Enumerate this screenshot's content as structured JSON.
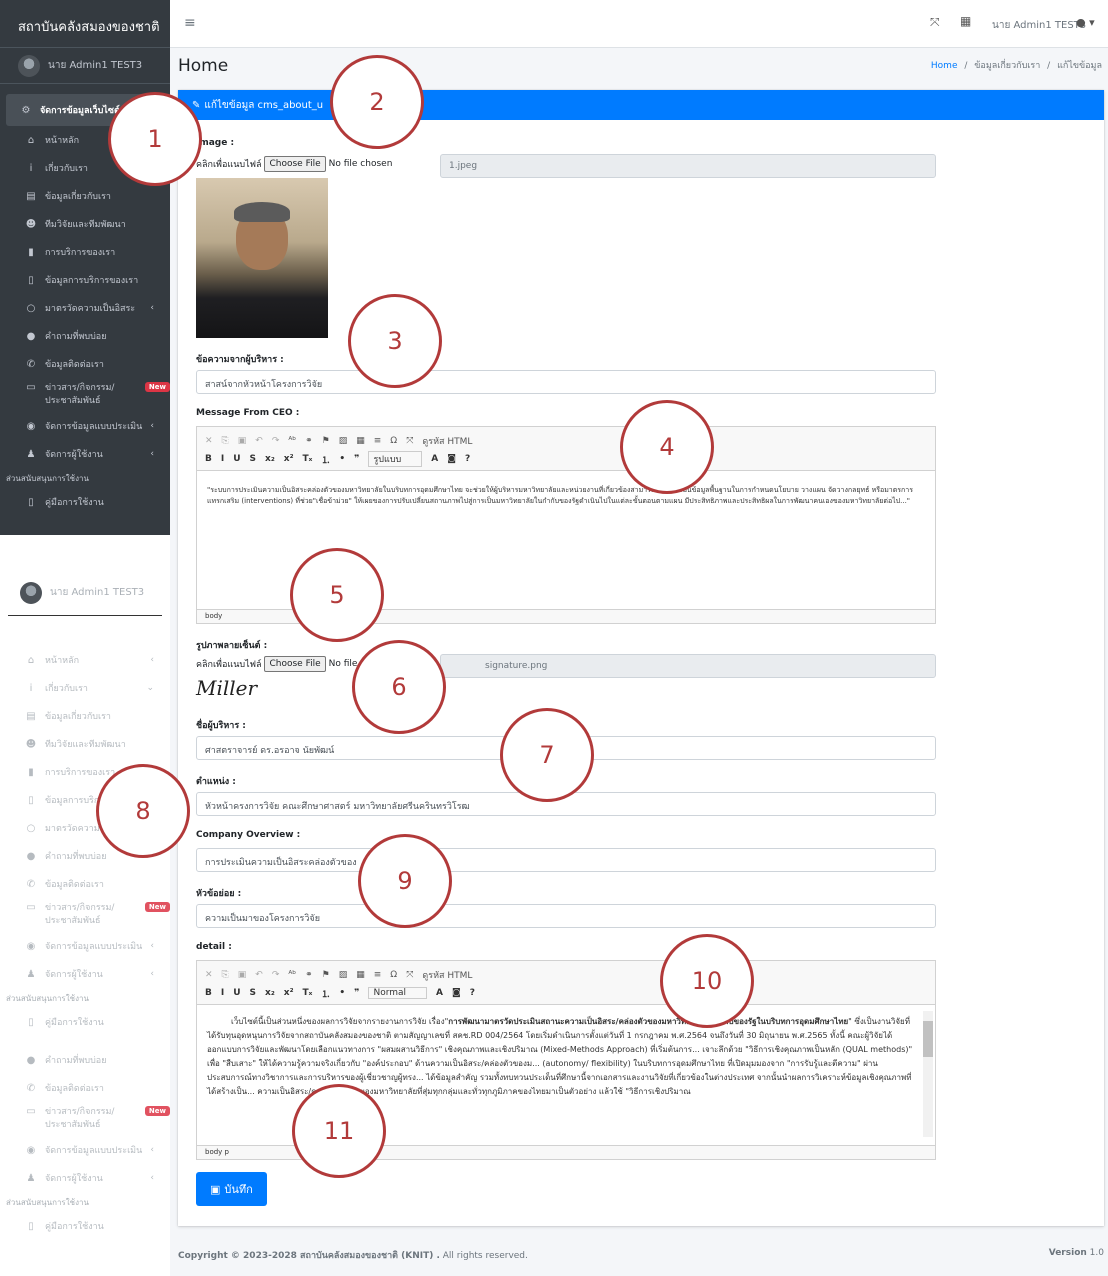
{
  "sidebar": {
    "brand": "สถาบันคลังสมองของชาติ",
    "user": "นาย Admin1 TEST3",
    "items": [
      {
        "label": "จัดการข้อมูลเว็บไซต์",
        "icon": "cogs-icon"
      },
      {
        "label": "หน้าหลัก",
        "icon": "home-icon"
      },
      {
        "label": "เกี่ยวกับเรา",
        "icon": "info-icon"
      },
      {
        "label": "ข้อมูลเกี่ยวกับเรา",
        "icon": "id-card-icon"
      },
      {
        "label": "ทีมวิจัยและทีมพัฒนา",
        "icon": "users-icon"
      },
      {
        "label": "การบริการของเรา",
        "icon": "clipboard-icon"
      },
      {
        "label": "ข้อมูลการบริการของเรา",
        "icon": "clipboard-list-icon"
      },
      {
        "label": "มาตรวัดความเป็นอิสระ",
        "icon": "circle-icon"
      },
      {
        "label": "คำถามที่พบบ่อย",
        "icon": "comments-icon"
      },
      {
        "label": "ข้อมูลติดต่อเรา",
        "icon": "phone-icon"
      },
      {
        "label": "ข่าวสาร/กิจกรรม/ประชาสัมพันธ์",
        "icon": "newspaper-icon",
        "badge": "New"
      },
      {
        "label": "จัดการข้อมูลแบบประเมิน",
        "icon": "palette-icon"
      },
      {
        "label": "จัดการผู้ใช้งาน",
        "icon": "user-icon"
      }
    ],
    "header": "ส่วนสนับสนุนการใช้งาน",
    "manual": "คู่มือการใช้งาน"
  },
  "topbar": {
    "menu_icon": "≡",
    "user": "นาย Admin1 TEST3"
  },
  "page": {
    "title": "Home",
    "breadcrumb": [
      "Home",
      "ข้อมูลเกี่ยวกับเรา",
      "แก้ไขข้อมูล"
    ]
  },
  "card": {
    "title": "แก้ไขข้อมูล cms_about_u"
  },
  "form": {
    "image_label": "Image :",
    "file_hint": "คลิกเพื่อแนบไฟล์",
    "choose_file": "Choose File",
    "no_file": "No file chosen",
    "image_name": "1.jpeg",
    "exec_msg_label": "ข้อความจากผู้บริหาร :",
    "exec_msg_value": "สาสน์จากหัวหน้าโครงการวิจัย",
    "ceo_label": "Message From CEO :",
    "ceo_text": "\"ระบบการประเมินความเป็นอิสระคล่องตัวของมหาวิทยาลัยในบริบทการอุดมศึกษาไทย จะช่วยให้ผู้บริหารมหาวิทยาลัยและหน่วยงานที่เกี่ยวข้องสามารถนำไปใช้เป็นข้อมูลพื้นฐานในการกำหนดนโยบาย วางแผน จัดวางกลยุทธ์ หรือมาตรการแทรกเสริม (interventions) ที่ช่วย\"เชื่อข้าม่วย\" ให้เผยของการปรับเปลี่ยนสถานภาพไปสู่การเป็นมหาวิทยาลัยในกำกับของรัฐดำเนินไปในแต่ละขั้นตอนตามแผน มีประสิทธิภาพและประสิทธิผลในการพัฒนาคนเองของมหาวิทยาลัยต่อไป...\"",
    "editor_status1": "body",
    "sig_label": "รูปภาพลายเซ็นต์ :",
    "sig_name": "signature.png",
    "sig_text": "Miller",
    "exec_name_label": "ชื่อผู้บริหาร :",
    "exec_name_value": "ศาสตราจารย์ ดร.อรอาจ นัยพัฒน์",
    "position_label": "ตำแหน่ง :",
    "position_value": "หัวหน้าครงการวิจัย คณะศึกษาศาสตร์ มหาวิทยาลัยศรีนครินทรวิโรฒ",
    "company_label": "Company Overview :",
    "company_value": "การประเมินความเป็นอิสระคล่องตัวของ",
    "topic_label": "หัวข้อย่อย :",
    "topic_value": "ความเป็นมาของโครงการวิจัย",
    "detail_label": "detail :",
    "detail_bold": "การพัฒนามาตรวัดประเมินสถานะความเป็นอิสระ/คล่องตัวของมหาวิทยาลัยในกำกับของรัฐในบริบทการอุดมศึกษาไทย",
    "detail_text1": "เว็บไซต์นี้เป็นส่วนหนึ่งของผลการวิจัยจากรายงานการวิจัย เรื่อง\"",
    "detail_text2": "\" ซึ่งเป็นงานวิจัยที่ได้รับทุนอุดหนุนการวิจัยจากสถาบันคลังสมองของชาติ ตามสัญญาเลขที่ สคช.RD 004/2564 โดยเริ่มดำเนินการตั้งแต่วันที่ 1 กรกฎาคม พ.ศ.2564 จนถึงวันที่ 30 มิถุนายน พ.ศ.2565 ทั้งนี้ คณะผู้วิจัยได้ออกแบบการวิจัยและพัฒนาโดยเลือกแนวทางการ \"ผสมผสานวิธีการ\" เชิงคุณภาพและเชิงปริมาณ (Mixed-Methods Approach) ที่เริ่มต้นการ... เจาะลึกด้วย \"วิธีการเชิงคุณภาพเป็นหลัก (QUAL methods)\" เพื่อ \"สืบเสาะ\" ให้ได้ความรู้ความจริงเกี่ยวกับ \"องค์ประกอบ\" ด้านความเป็นอิสระ/คล่องตัวของม... (autonomy/ flexibility) ในบริบทการอุดมศึกษาไทย ที่เปิดมุมมองจาก \"การรับรู้และตีความ\" ผ่านประสบการณ์ทางวิชาการและการบริหารของผู้เชี่ยวชาญผู้ทรง... ได้ข้อมูลสำคัญ รวมทั้งทบทวนประเด็นที่ศึกษานี้จากเอกสารและงานวิจัยที่เกี่ยวข้องในต่างประเทศ จากนั้นนำผลการวิเคราะห์ข้อมูลเชิงคุณภาพที่ได้สร้างเป็น... ความเป็นอิสระ/ความคล่องตัวของมหาวิทยาลัยที่สุ่มทุกกลุ่มและทั่วทุกภูมิภาคของไทยมาเป็นตัวอย่าง แล้วใช้ \"วิธีการเชิงปริมาณ",
    "editor_status2": "body  p",
    "save": "บันทึก",
    "format1": "รูปแบบ",
    "format2": "Normal",
    "source_html": "ดูรหัส HTML"
  },
  "footer": {
    "copyright": "Copyright © 2023-2028 สถาบันคลังสมองของชาติ (KNIT) .",
    "rights": "All rights reserved.",
    "version_label": "Version",
    "version": "1.0"
  },
  "callouts": [
    "1",
    "2",
    "3",
    "4",
    "5",
    "6",
    "7",
    "8",
    "9",
    "10",
    "11"
  ]
}
